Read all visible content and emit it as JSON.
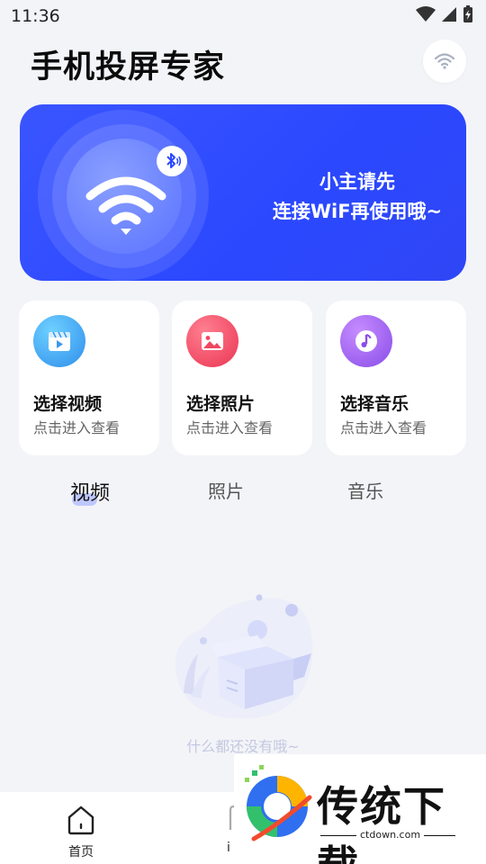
{
  "status_bar": {
    "time": "11:36"
  },
  "header": {
    "title": "手机投屏专家"
  },
  "banner": {
    "line1": "小主请先",
    "line2": "连接WiF再使用哦~"
  },
  "cards": [
    {
      "title": "选择视频",
      "subtitle": "点击进入查看",
      "icon": "video-icon",
      "color": "#35a3f2"
    },
    {
      "title": "选择照片",
      "subtitle": "点击进入查看",
      "icon": "photo-icon",
      "color": "#f0465e"
    },
    {
      "title": "选择音乐",
      "subtitle": "点击进入查看",
      "icon": "music-icon",
      "color": "#9b5cf0"
    }
  ],
  "tabs": [
    "视频",
    "照片",
    "音乐"
  ],
  "empty": {
    "message": "什么都还没有哦~"
  },
  "bottom_nav": {
    "home_label": "首页",
    "second_label": "i"
  },
  "watermark": {
    "text": "传统下载",
    "domain": "ctdown.com"
  },
  "colors": {
    "accent": "#2b48ff",
    "background": "#f3f4f8"
  }
}
